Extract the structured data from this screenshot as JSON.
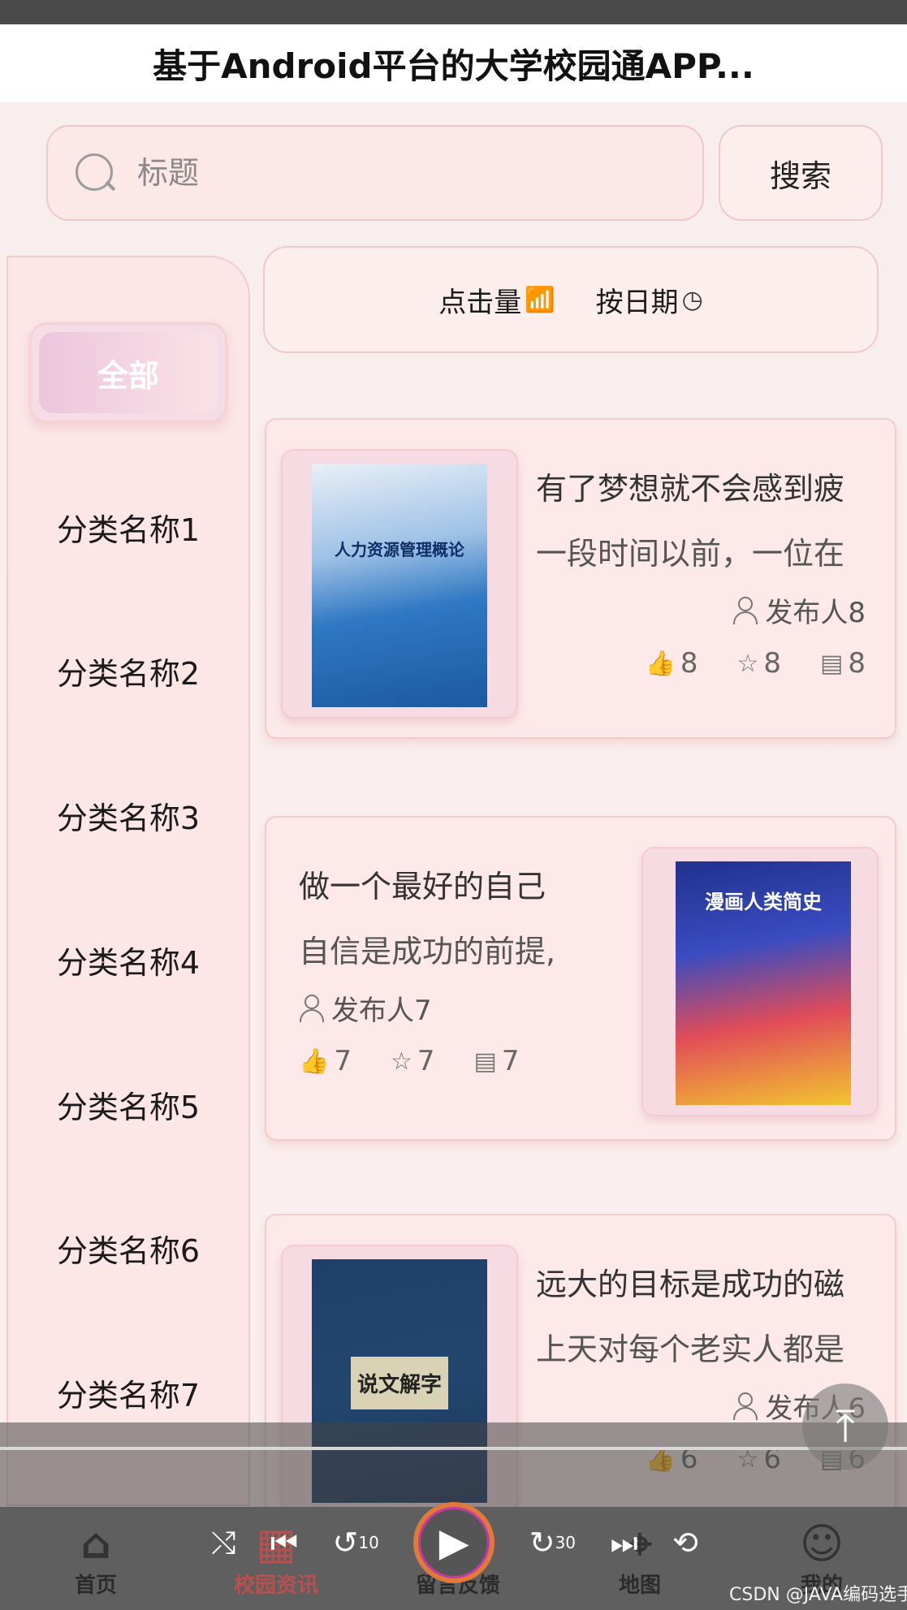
{
  "header": {
    "title": "基于Android平台的大学校园通APP..."
  },
  "search": {
    "placeholder": "标题",
    "button_label": "搜索"
  },
  "sidebar": {
    "all_label": "全部",
    "items": [
      {
        "label": "分类名称1"
      },
      {
        "label": "分类名称2"
      },
      {
        "label": "分类名称3"
      },
      {
        "label": "分类名称4"
      },
      {
        "label": "分类名称5"
      },
      {
        "label": "分类名称6"
      },
      {
        "label": "分类名称7"
      }
    ]
  },
  "sort": {
    "clicks_label": "点击量",
    "date_label": "按日期"
  },
  "cards": [
    {
      "title": "有了梦想就不会感到疲",
      "desc": "一段时间以前，一位在",
      "author": "发布人8",
      "likes": "8",
      "favorites": "8",
      "comments": "8",
      "cover_text": "人力资源管理概论"
    },
    {
      "title": "做一个最好的自己",
      "desc": "自信是成功的前提,",
      "author": "发布人7",
      "likes": "7",
      "favorites": "7",
      "comments": "7",
      "cover_text": "漫画人类简史"
    },
    {
      "title": "远大的目标是成功的磁",
      "desc": "上天对每个老实人都是",
      "author": "发布人6",
      "likes": "6",
      "favorites": "6",
      "comments": "6",
      "cover_text": "说文解字"
    }
  ],
  "tabs": [
    {
      "label": "首页"
    },
    {
      "label": "校园资讯"
    },
    {
      "label": "留言反馈"
    },
    {
      "label": "地图"
    },
    {
      "label": "我的"
    }
  ],
  "media": {
    "rewind_label": "10",
    "forward_label": "30"
  },
  "watermark": "CSDN @JAVA编码选手",
  "colors": {
    "accent": "#f6dce4",
    "background": "#fce6e6",
    "active_tab": "#b85050"
  }
}
